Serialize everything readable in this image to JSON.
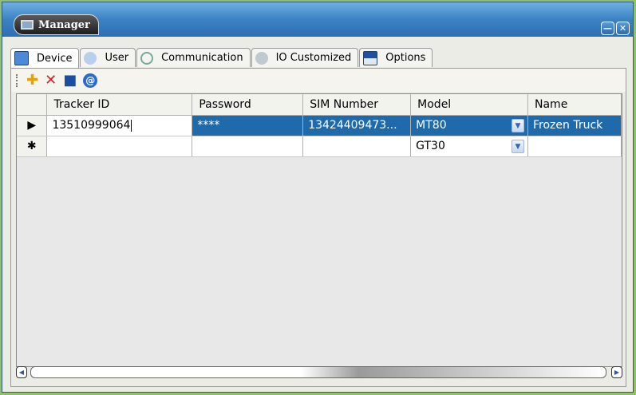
{
  "window": {
    "title": "Manager",
    "minimize_label": "—",
    "close_label": "✕"
  },
  "tabs": [
    {
      "label": "Device",
      "icon": "device-icon",
      "active": true
    },
    {
      "label": "User",
      "icon": "user-icon",
      "active": false
    },
    {
      "label": "Communication",
      "icon": "communication-icon",
      "active": false
    },
    {
      "label": "IO Customized",
      "icon": "io-gear-icon",
      "active": false
    },
    {
      "label": "Options",
      "icon": "options-icon",
      "active": false
    }
  ],
  "toolbar": {
    "add": "✚",
    "delete": "✕",
    "save": "■",
    "info": "@"
  },
  "grid": {
    "columns": [
      "Tracker ID",
      "Password",
      "SIM Number",
      "Model",
      "Name"
    ],
    "rows": [
      {
        "marker": "▶",
        "tracker_id": "13510999064",
        "password": "****",
        "sim": "13424409473...",
        "model": "MT80",
        "name": "Frozen Truck"
      },
      {
        "marker": "✱",
        "tracker_id": "",
        "password": "",
        "sim": "",
        "model": "GT30",
        "name": ""
      }
    ],
    "dropdown_glyph": "▼"
  },
  "scroll": {
    "left": "◀",
    "right": "▶"
  }
}
